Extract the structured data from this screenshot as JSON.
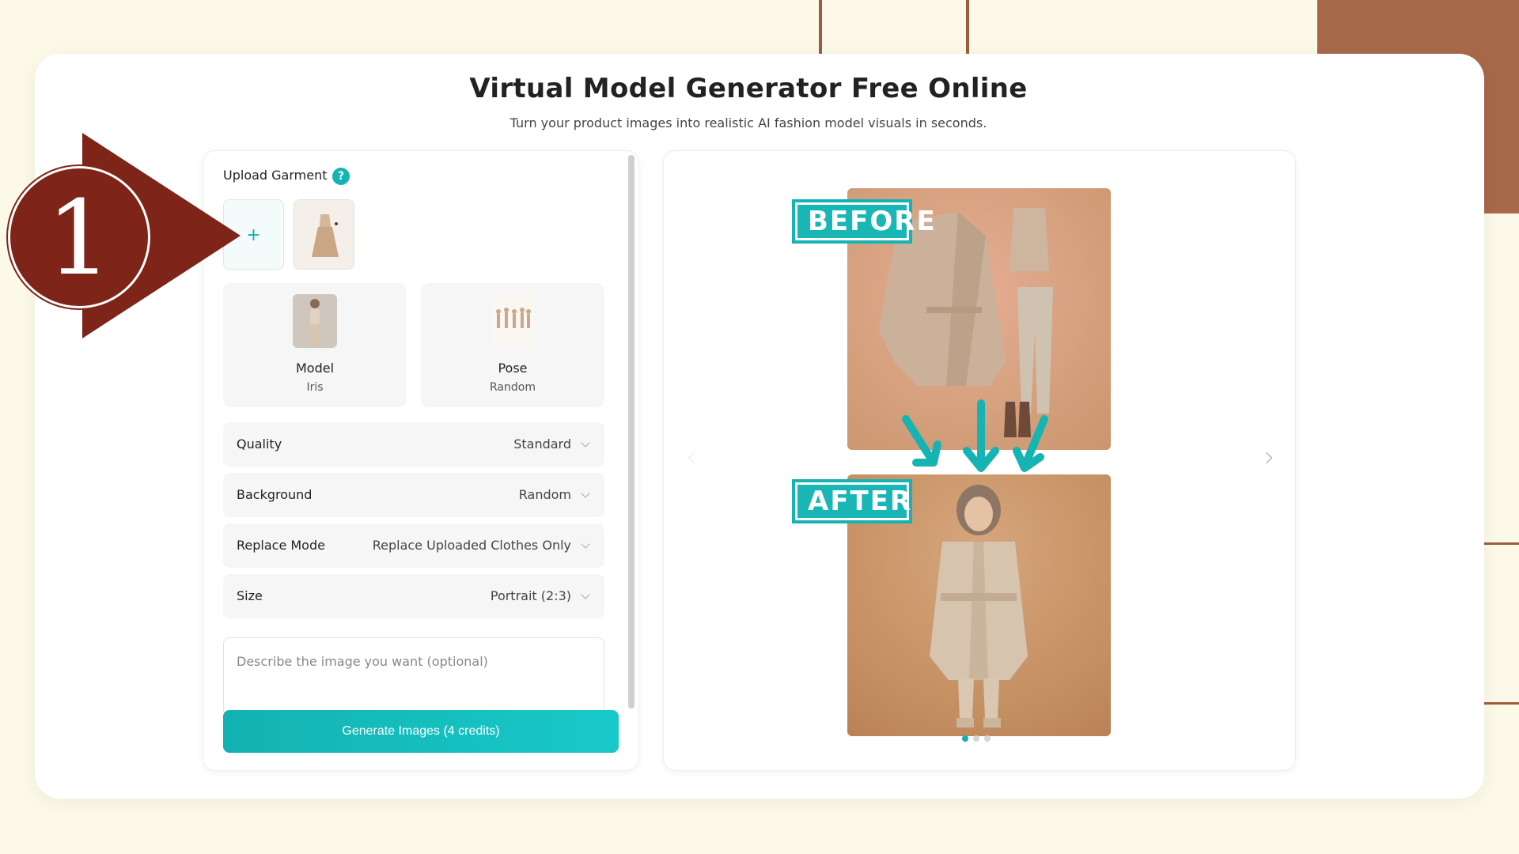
{
  "header": {
    "title": "Virtual Model Generator Free Online",
    "subtitle": "Turn your product images into realistic AI fashion model visuals in seconds."
  },
  "upload": {
    "label": "Upload Garment",
    "help_icon": "?",
    "add_icon": "+"
  },
  "model": {
    "title": "Model",
    "value": "Iris"
  },
  "pose": {
    "title": "Pose",
    "value": "Random"
  },
  "settings": [
    {
      "label": "Quality",
      "value": "Standard"
    },
    {
      "label": "Background",
      "value": "Random"
    },
    {
      "label": "Replace Mode",
      "value": "Replace Uploaded Clothes Only"
    },
    {
      "label": "Size",
      "value": "Portrait (2:3)"
    }
  ],
  "prompt": {
    "placeholder": "Describe the image you want (optional)"
  },
  "generate": {
    "label": "Generate Images (4 credits)"
  },
  "preview": {
    "before_stamp": "BEFORE",
    "after_stamp": "AFTER",
    "dots": 3,
    "active_dot": 0
  },
  "callout": {
    "number": "1"
  },
  "colors": {
    "accent": "#16b3b3",
    "callout": "#7e2418",
    "background": "#fcf9e8"
  }
}
